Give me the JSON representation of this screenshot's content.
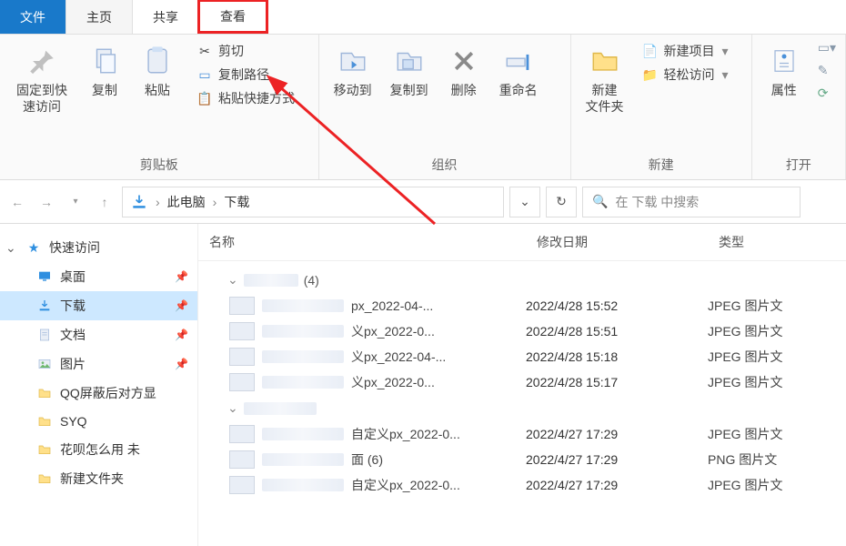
{
  "tabs": {
    "file": "文件",
    "home": "主页",
    "share": "共享",
    "view": "查看"
  },
  "ribbon": {
    "clipboard": {
      "pin": "固定到快速访问",
      "copy": "复制",
      "paste": "粘贴",
      "cut": "剪切",
      "copy_path": "复制路径",
      "paste_shortcut": "粘贴快捷方式",
      "label": "剪贴板"
    },
    "organize": {
      "move_to": "移动到",
      "copy_to": "复制到",
      "delete": "删除",
      "rename": "重命名",
      "label": "组织"
    },
    "new": {
      "new_folder": "新建\n文件夹",
      "new_item": "新建项目",
      "easy_access": "轻松访问",
      "label": "新建"
    },
    "open": {
      "properties": "属性",
      "label": "打开"
    }
  },
  "breadcrumb": {
    "root": "此电脑",
    "current": "下载"
  },
  "search": {
    "placeholder": "在 下载 中搜索"
  },
  "columns": {
    "name": "名称",
    "date": "修改日期",
    "type": "类型"
  },
  "sidebar": {
    "quick_access": "快速访问",
    "items": [
      {
        "icon": "desktop",
        "label": "桌面",
        "pinned": true
      },
      {
        "icon": "download",
        "label": "下载",
        "pinned": true,
        "selected": true
      },
      {
        "icon": "document",
        "label": "文档",
        "pinned": true
      },
      {
        "icon": "picture",
        "label": "图片",
        "pinned": true
      },
      {
        "icon": "folder",
        "label": "QQ屏蔽后对方显"
      },
      {
        "icon": "folder",
        "label": "SYQ"
      },
      {
        "icon": "folder",
        "label": "花呗怎么用   未"
      },
      {
        "icon": "folder",
        "label": "新建文件夹"
      }
    ]
  },
  "files": {
    "group1_count": "(4)",
    "rows": [
      {
        "name": "px_2022-04-...",
        "date": "2022/4/28 15:52",
        "type": "JPEG 图片文"
      },
      {
        "name": "义px_2022-0...",
        "date": "2022/4/28 15:51",
        "type": "JPEG 图片文"
      },
      {
        "name": "义px_2022-04-...",
        "date": "2022/4/28 15:18",
        "type": "JPEG 图片文"
      },
      {
        "name": "义px_2022-0...",
        "date": "2022/4/28 15:17",
        "type": "JPEG 图片文"
      }
    ],
    "rows2": [
      {
        "name": "自定义px_2022-0...",
        "date": "2022/4/27 17:29",
        "type": "JPEG 图片文"
      },
      {
        "name": "面 (6)",
        "date": "2022/4/27 17:29",
        "type": "PNG 图片文"
      },
      {
        "name": "自定义px_2022-0...",
        "date": "2022/4/27 17:29",
        "type": "JPEG 图片文"
      }
    ]
  }
}
